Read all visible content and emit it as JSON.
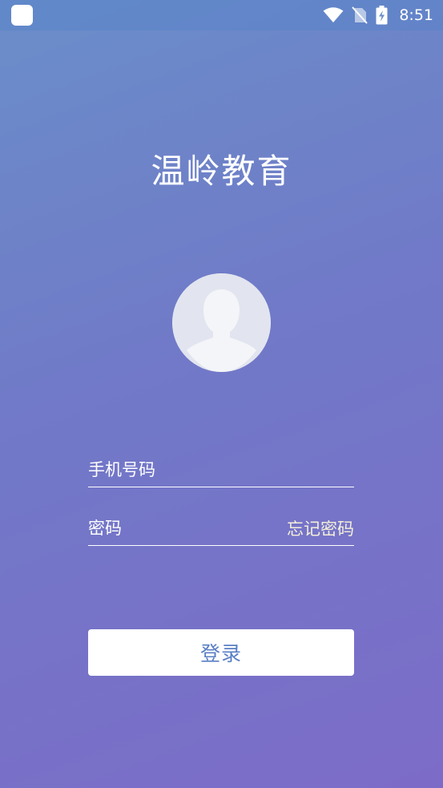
{
  "status_bar": {
    "time": "8:51",
    "icons": [
      "app-icon",
      "wifi-icon",
      "no-sim-icon",
      "battery-charging-icon"
    ]
  },
  "app": {
    "title": "温岭教育"
  },
  "avatar": {
    "icon": "default-user-avatar-icon"
  },
  "login_form": {
    "phone_placeholder": "手机号码",
    "phone_value": "",
    "password_placeholder": "密码",
    "password_value": "",
    "forgot_password_label": "忘记密码",
    "login_label": "登录"
  },
  "colors": {
    "gradient_top": "#6a8ec9",
    "gradient_bottom": "#7c6cc8",
    "button_text": "#5a7fc4",
    "forgot_link": "#f4efd8"
  }
}
